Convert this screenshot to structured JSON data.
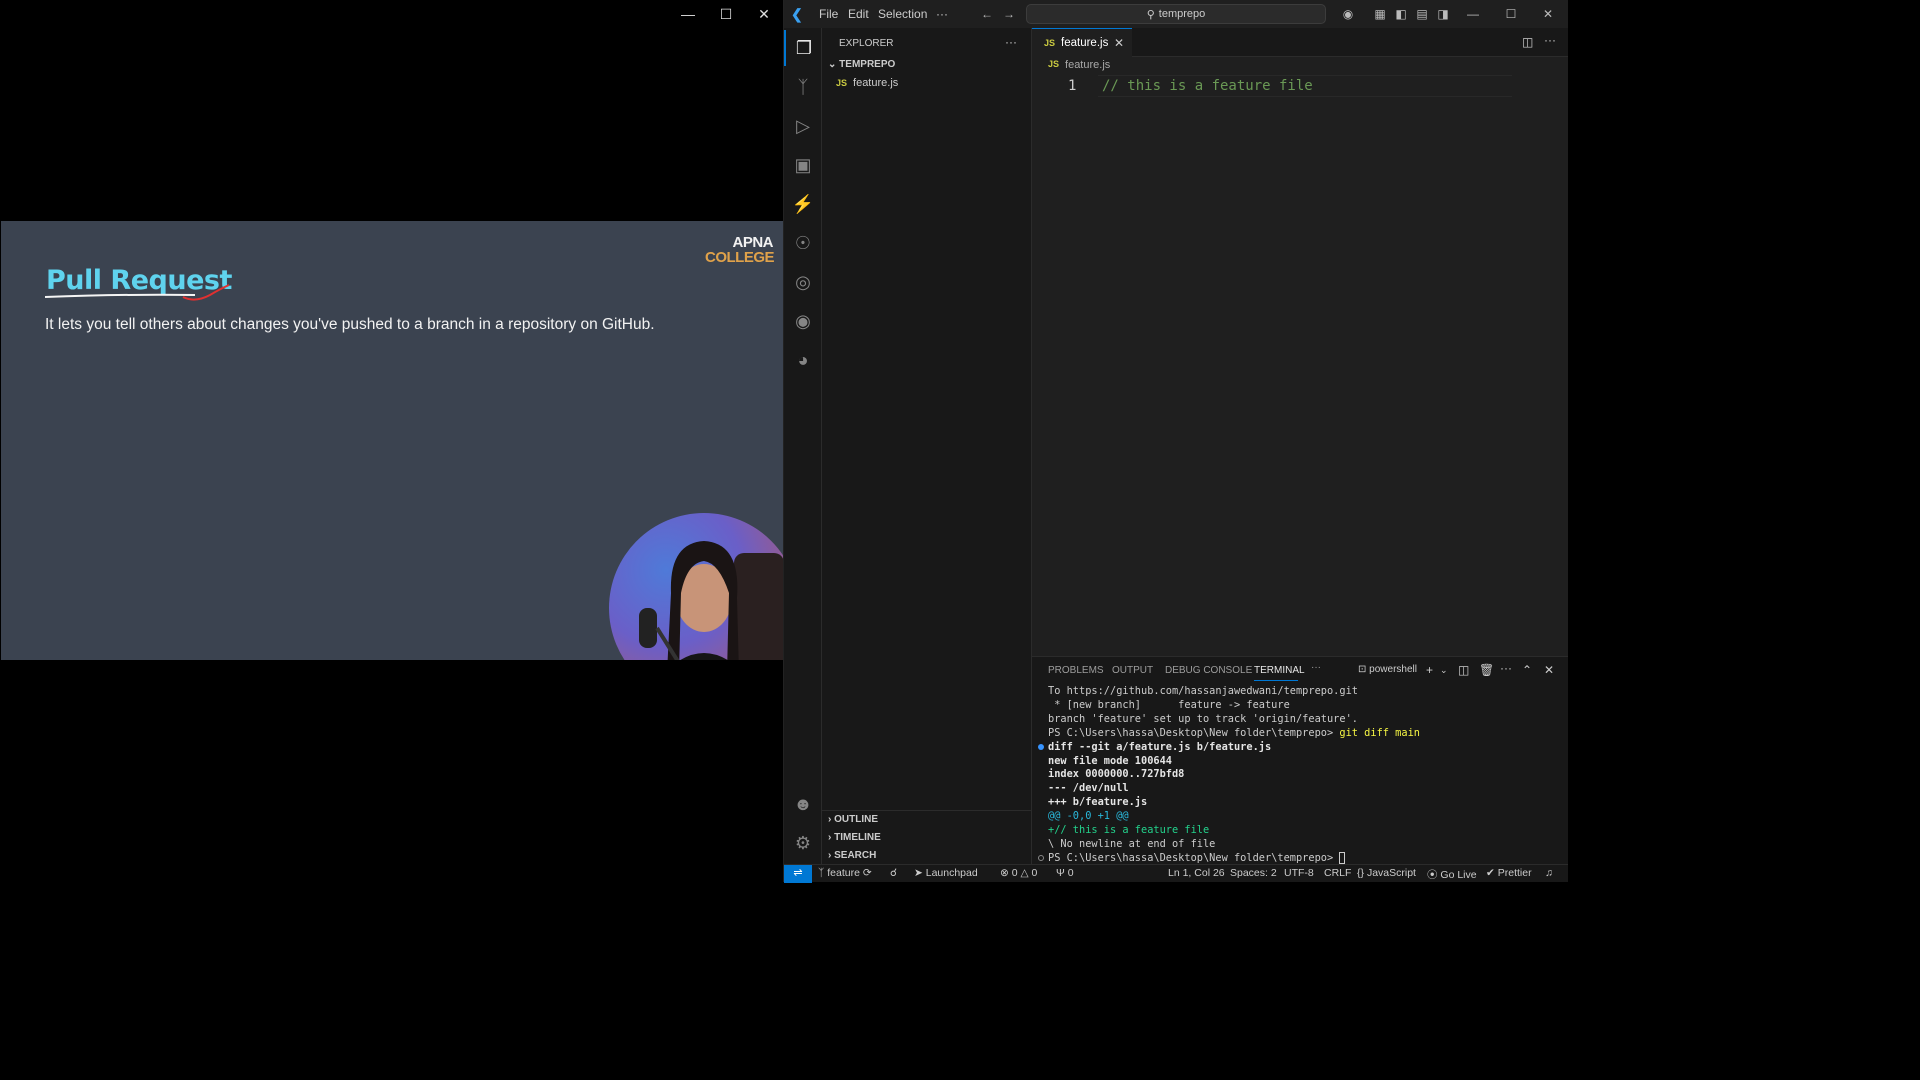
{
  "video": {
    "slide_title": "Pull Request",
    "slide_text": "It lets you tell others about changes you've pushed to a branch in a repository on GitHub.",
    "logo_line1": "APNA",
    "logo_line2": "COLLEGE"
  },
  "titlebar": {
    "menu": [
      "File",
      "Edit",
      "Selection",
      "···"
    ],
    "search_text": "temprepo"
  },
  "sidebar": {
    "title": "EXPLORER",
    "more": "···",
    "folder": "TEMPREPO",
    "file": "feature.js",
    "file_badge": "JS",
    "sections": [
      "OUTLINE",
      "TIMELINE",
      "SEARCH"
    ]
  },
  "editor": {
    "tab_label": "feature.js",
    "tab_badge": "JS",
    "breadcrumb": "feature.js",
    "line_number": "1",
    "code": "// this is a feature file"
  },
  "panel": {
    "tabs": [
      "PROBLEMS",
      "OUTPUT",
      "DEBUG CONSOLE",
      "TERMINAL",
      "···"
    ],
    "shell": "powershell",
    "terminal_lines": [
      "To https://github.com/hassanjawedwani/temprepo.git",
      " * [new branch]      feature -> feature",
      "branch 'feature' set up to track 'origin/feature'.",
      "PS C:\\Users\\hassa\\Desktop\\New folder\\temprepo> ",
      "diff --git a/feature.js b/feature.js",
      "new file mode 100644",
      "index 0000000..727bfd8",
      "--- /dev/null",
      "+++ b/feature.js",
      "@@ -0,0 +1 @@",
      "+// this is a feature file",
      "\\ No newline at end of file",
      "PS C:\\Users\\hassa\\Desktop\\New folder\\temprepo> "
    ],
    "command": "git diff main"
  },
  "statusbar": {
    "branch": "feature",
    "launchpad": "Launchpad",
    "errors": "0",
    "warnings": "0",
    "ports": "0",
    "position": "Ln 1, Col 26",
    "spaces": "Spaces: 2",
    "encoding": "UTF-8",
    "eol": "CRLF",
    "language": "JavaScript",
    "golive": "Go Live",
    "prettier": "Prettier"
  }
}
